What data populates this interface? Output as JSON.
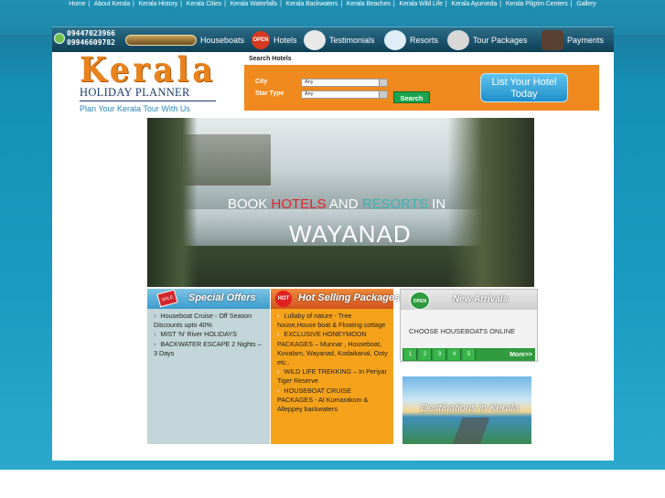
{
  "top_links": [
    "Home",
    "About Kerala",
    "Kerala History",
    "Kerala Cities",
    "Kerala Waterfalls",
    "Kerala Backwaters",
    "Kerala Beaches",
    "Kerala Wild Life",
    "Kerala Ayurveda",
    "Kerala Pilgrim Centers",
    "Gallery"
  ],
  "phones": [
    "09447023966",
    "09946609782"
  ],
  "nav": {
    "houseboats": "Houseboats",
    "hotels": "Hotels",
    "hotels_badge": "OPEN",
    "testimonials": "Testimonials",
    "resorts": "Resorts",
    "tour_packages": "Tour Packages",
    "payments": "Payments"
  },
  "logo": {
    "kerala": "Kerala",
    "holiday_planner": "HOLIDAY PLANNER",
    "tagline": "Plan Your Kerala Tour With Us"
  },
  "search": {
    "title": "Search Hotels",
    "city_label": "City",
    "city_value": "Any",
    "star_label": "Star Type",
    "star_value": "Any",
    "button": "Search",
    "list_hotel": "List Your Hotel Today"
  },
  "banner": {
    "book": "BOOK",
    "hotels": "HOTELS",
    "and": "AND",
    "resorts": "RESORTS",
    "in": "IN",
    "place": "WAYANAD"
  },
  "special_offers": {
    "title": "Special Offers",
    "badge": "SALE",
    "items": [
      "Houseboat Cruise - Off Season Discounts upto 40%",
      "MIST 'N' River HOLIDAYS",
      "BACKWATER ESCAPE 2 Nights – 3 Days"
    ]
  },
  "hot_packages": {
    "title": "Hot Selling Packages",
    "badge": "HOT",
    "items": [
      "Lullaby of nature - Tree house,House boat & Floating cottage",
      "EXCLUSIVE HONEYMOON PACKAGES – Munnar , Houseboat, Kovalam, Wayanad, Kodaikanal, Ooty etc..",
      "WILD LIFE TREKKING – In Periyar Tiger Reserve",
      "HOUSEBOAT CRUISE PACKAGES - At Kumarakom & Alleppey backwaters"
    ]
  },
  "new_arrivals": {
    "title": "New Arrivals",
    "badge": "OPEN",
    "text": "CHOOSE HOUSEBOATS ONLINE",
    "pages": [
      "1",
      "2",
      "3",
      "4",
      "5"
    ],
    "more": "More>>"
  },
  "destinations": {
    "title": "Destinations in Kerala"
  }
}
